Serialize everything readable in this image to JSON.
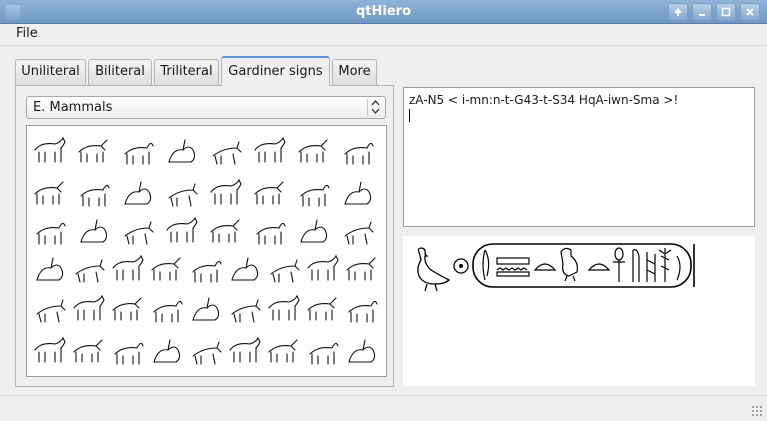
{
  "window": {
    "title": "qtHiero"
  },
  "menu": {
    "items": [
      "File"
    ]
  },
  "tabs": [
    {
      "label": "Uniliteral",
      "active": false
    },
    {
      "label": "Biliteral",
      "active": false
    },
    {
      "label": "Triliteral",
      "active": false
    },
    {
      "label": "Gardiner signs",
      "active": true
    },
    {
      "label": "More",
      "active": false
    }
  ],
  "category": {
    "selected": "E. Mammals"
  },
  "glyph_grid": {
    "rows": 6,
    "row_counts": [
      8,
      8,
      8,
      9,
      9,
      9
    ],
    "icons": [
      "mammal-sign-icon"
    ]
  },
  "editor": {
    "text": "zA-N5 < i-mn:n-t-G43-t-S34 HqA-iwn-Sma >!"
  },
  "preview": {
    "icons": [
      "duck-icon",
      "sun-disc-icon",
      "cartouche-icon",
      "water-ripples-icon",
      "bread-loaf-icon",
      "quail-chick-icon",
      "ankh-icon",
      "sceptre-icon",
      "sedge-plant-icon"
    ]
  },
  "colors": {
    "title_bar": "#7fa4cb",
    "tab_accent": "#5a93d0",
    "background": "#efefef"
  }
}
